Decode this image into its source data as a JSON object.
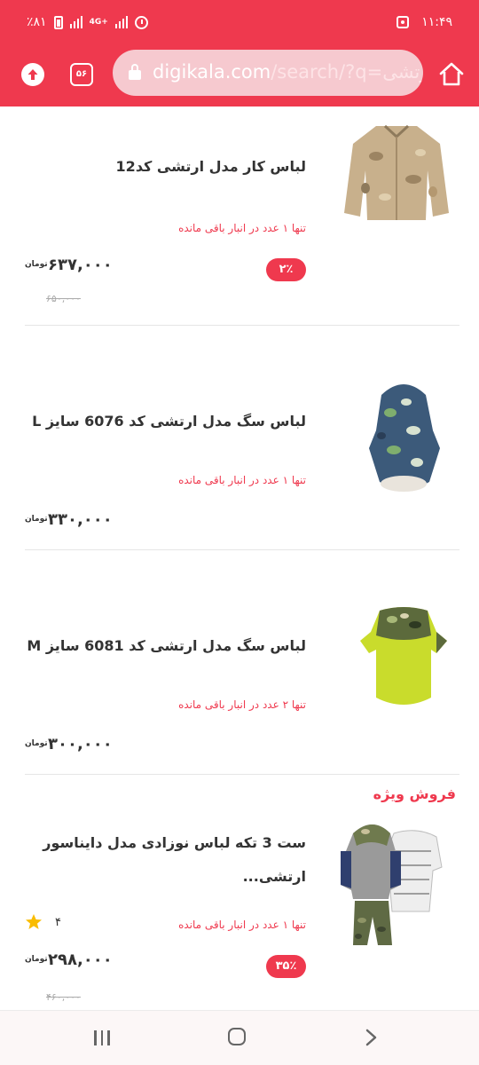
{
  "status_bar": {
    "time": "۱۱:۴۹",
    "battery": "٪۸۱",
    "network": "4G+"
  },
  "browser": {
    "url_host": "digikala.com",
    "url_path": "/search/?q=",
    "url_query": "ارتشی",
    "tab_count": "۵۶"
  },
  "products": [
    {
      "title": "لباس کار مدل ارتشی کد12",
      "stock": "تنها ۱ عدد در انبار باقی مانده",
      "discount": "۲٪",
      "price": "۶۳۷,۰۰۰",
      "currency": "تومان",
      "old_price": "۶۵۰,۰۰۰"
    },
    {
      "title": "لباس سگ مدل ارتشی کد 6076 سایز L",
      "stock": "تنها ۱ عدد در انبار باقی مانده",
      "price": "۳۳۰,۰۰۰",
      "currency": "تومان"
    },
    {
      "title": "لباس سگ مدل ارتشی کد 6081 سایز M",
      "stock": "تنها ۲ عدد در انبار باقی مانده",
      "price": "۳۰۰,۰۰۰",
      "currency": "تومان"
    },
    {
      "badge": "فروش ویژه",
      "title": "ست 3 تکه لباس نوزادی مدل دایناسور ارتشی...",
      "stock": "تنها ۱ عدد در انبار باقی مانده",
      "rating": "۴",
      "discount": "۳۵٪",
      "price": "۲۹۸,۰۰۰",
      "currency": "تومان",
      "old_price": "۴۶۰,۰۰۰"
    }
  ],
  "colors": {
    "brand": "#ef394e",
    "text": "#333333",
    "star": "#f9bc00"
  },
  "icons": {
    "upload": "upload-icon",
    "home": "home-icon",
    "lock": "lock-icon",
    "star": "star-icon"
  }
}
